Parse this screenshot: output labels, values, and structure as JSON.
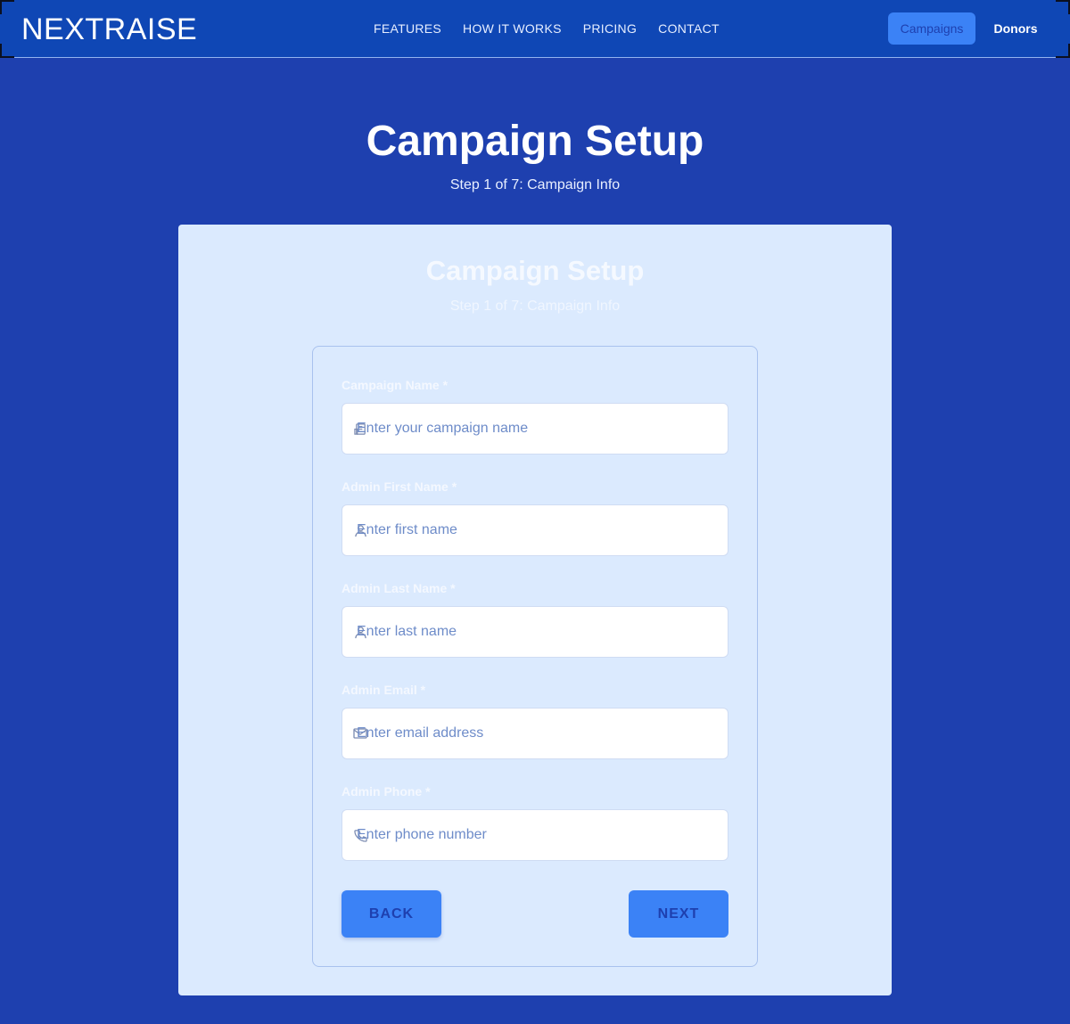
{
  "nav": {
    "logo": "NEXTRAISE",
    "links": [
      "FEATURES",
      "HOW IT WORKS",
      "PRICING",
      "CONTACT"
    ],
    "campaigns_label": "Campaigns",
    "donors_label": "Donors"
  },
  "header": {
    "title": "Campaign Setup",
    "subtitle": "Step 1 of 7: Campaign Info"
  },
  "panel": {
    "title": "Campaign Setup",
    "subtitle": "Step 1 of 7: Campaign Info"
  },
  "form": {
    "fields": [
      {
        "label": "Campaign Name *",
        "placeholder": "Enter your campaign name",
        "value": "",
        "icon": "building-icon"
      },
      {
        "label": "Admin First Name *",
        "placeholder": "Enter first name",
        "value": "",
        "icon": "user-icon"
      },
      {
        "label": "Admin Last Name *",
        "placeholder": "Enter last name",
        "value": "",
        "icon": "user-icon"
      },
      {
        "label": "Admin Email *",
        "placeholder": "Enter email address",
        "value": "",
        "icon": "envelope-icon"
      },
      {
        "label": "Admin Phone *",
        "placeholder": "Enter phone number",
        "value": "",
        "icon": "phone-icon"
      }
    ],
    "back_label": "BACK",
    "next_label": "NEXT"
  },
  "colors": {
    "background": "#1e40af",
    "navbar": "#0f47b5",
    "panel": "#dbeafe",
    "accent": "#3b82f6"
  }
}
